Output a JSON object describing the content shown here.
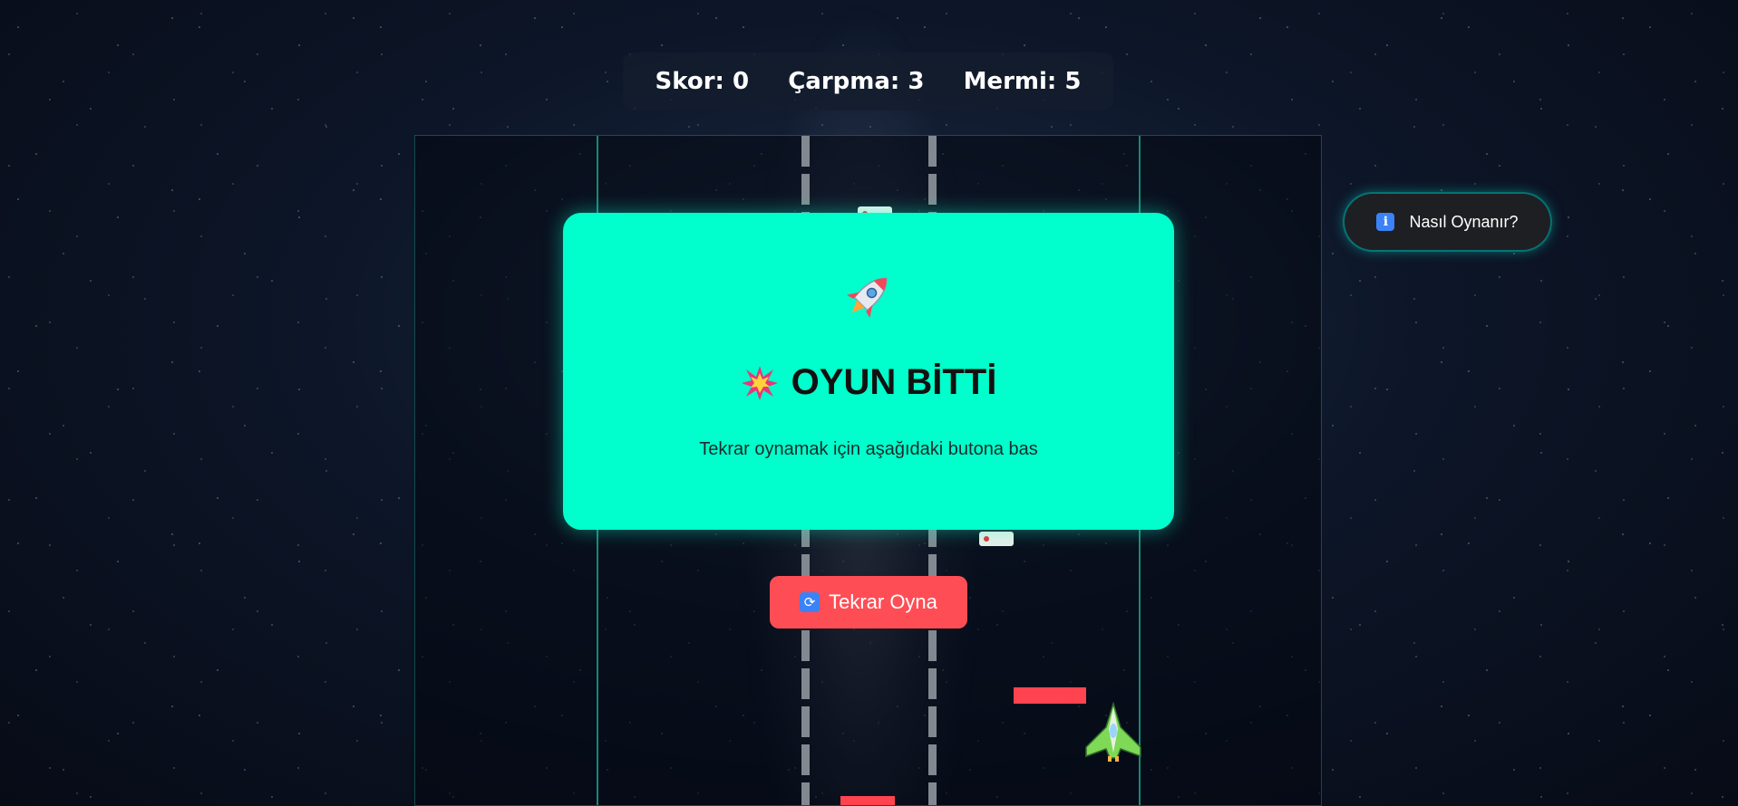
{
  "hud": {
    "score": "Skor: 0",
    "crashes": "Çarpma: 3",
    "ammo": "Mermi: 5"
  },
  "game_over": {
    "title": "OYUN BİTTİ",
    "subtitle": "Tekrar oynamak için aşağıdaki butona bas",
    "card_color": "#00ffcc",
    "icons": [
      "rocket-icon",
      "explosion-icon"
    ]
  },
  "replay_button": {
    "label": "Tekrar Oyna",
    "icon": "refresh-icon",
    "color": "#ff4d55"
  },
  "help_button": {
    "label": "Nasıl Oynanır?",
    "icon": "info-icon"
  },
  "colors": {
    "obstacle": "#ff4450",
    "lane_edge": "#1aa88f"
  }
}
